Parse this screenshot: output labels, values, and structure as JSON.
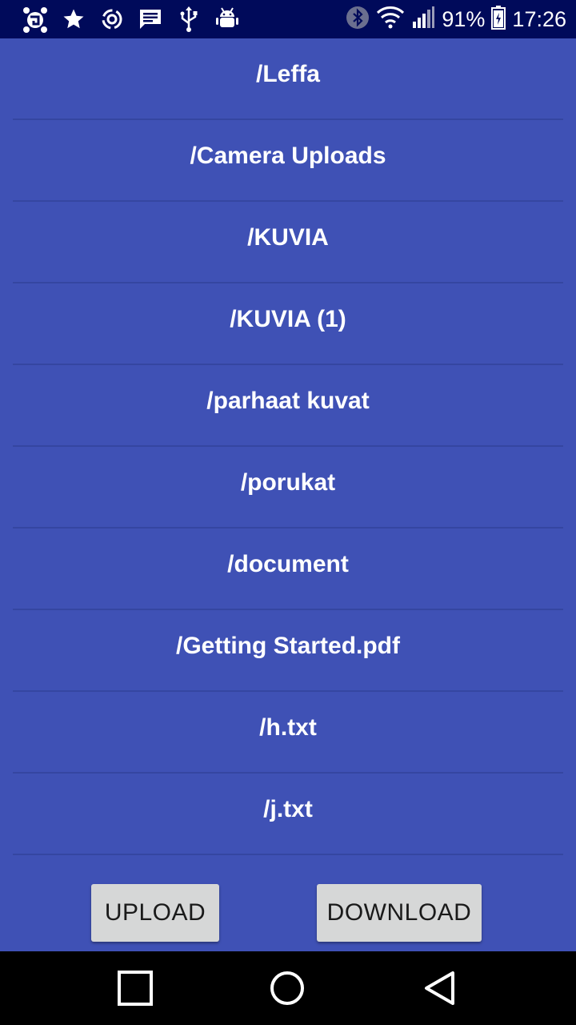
{
  "status_bar": {
    "left_icons": [
      "avast-icon",
      "star-icon",
      "sync-icon",
      "message-icon",
      "usb-icon",
      "android-debug-icon"
    ],
    "right_icons": [
      "bluetooth-icon",
      "wifi-icon",
      "signal-icon"
    ],
    "battery_percent": "91%",
    "time": "17:26",
    "background_color": "#000a5a"
  },
  "file_list": {
    "items": [
      {
        "label": "/Leffa"
      },
      {
        "label": "/Camera Uploads"
      },
      {
        "label": "/KUVIA"
      },
      {
        "label": "/KUVIA (1)"
      },
      {
        "label": "/parhaat kuvat"
      },
      {
        "label": "/porukat"
      },
      {
        "label": "/document"
      },
      {
        "label": "/Getting Started.pdf"
      },
      {
        "label": "/h.txt"
      },
      {
        "label": "/j.txt"
      }
    ],
    "background_color": "#3f51b5"
  },
  "actions": {
    "upload_label": "UPLOAD",
    "download_label": "DOWNLOAD"
  },
  "nav_bar": {
    "icons": [
      "recents-icon",
      "home-icon",
      "back-icon"
    ]
  }
}
